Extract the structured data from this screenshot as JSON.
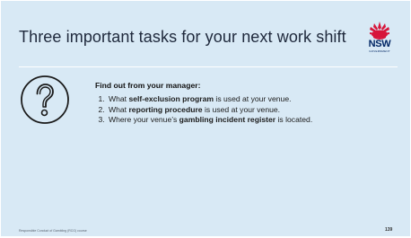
{
  "slide": {
    "title": "Three important tasks for your next work shift",
    "logo": {
      "wordmark": "NSW",
      "subtext": "GOVERNMENT",
      "icon": "waratah-flower-icon",
      "flower_color": "#d7153a",
      "text_color": "#002664"
    },
    "content_icon": "question-mark-circle-icon",
    "lead": "Find out from your manager:",
    "tasks": [
      {
        "pre": "What ",
        "bold": "self-exclusion program",
        "post": " is used at your venue."
      },
      {
        "pre": "What ",
        "bold": "reporting procedure",
        "post": " is used at your venue."
      },
      {
        "pre": "Where your venue’s ",
        "bold": "gambling incident register",
        "post": " is located."
      }
    ],
    "footer": "Responsible Conduct of Gambling (RCG) course",
    "page_number": "139",
    "background_color": "#d8e9f5"
  }
}
